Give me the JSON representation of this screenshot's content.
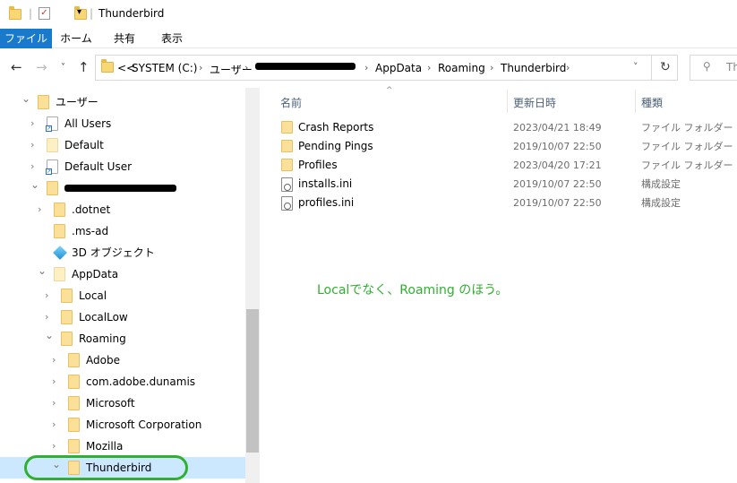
{
  "window": {
    "title": "Thunderbird"
  },
  "ribbon": {
    "tabs": [
      {
        "label": "ファイル",
        "active": true
      },
      {
        "label": "ホーム"
      },
      {
        "label": "共有"
      },
      {
        "label": "表示"
      }
    ],
    "active_color": "#1979ca"
  },
  "address": {
    "overflow": "<<",
    "crumbs": [
      "SYSTEM (C:)",
      "ユーザー",
      "AppData",
      "Roaming",
      "Thunderbird"
    ],
    "search_placeholder": "Th"
  },
  "nav": {
    "items": [
      {
        "label": "ユーザー",
        "indent": 0,
        "expanded": true,
        "icon": "folder"
      },
      {
        "label": "All Users",
        "indent": 1,
        "expanded": false,
        "icon": "shortcut-folder"
      },
      {
        "label": "Default",
        "indent": 1,
        "expanded": false,
        "icon": "folder-light"
      },
      {
        "label": "Default User",
        "indent": 1,
        "expanded": false,
        "icon": "shortcut-folder"
      },
      {
        "label": "",
        "indent": 1,
        "expanded": true,
        "icon": "folder",
        "redacted": true
      },
      {
        "label": ".dotnet",
        "indent": 2,
        "expanded": false,
        "icon": "folder"
      },
      {
        "label": ".ms-ad",
        "indent": 2,
        "expanded": null,
        "icon": "folder"
      },
      {
        "label": "3D オブジェクト",
        "indent": 2,
        "expanded": null,
        "icon": "3d-objects"
      },
      {
        "label": "AppData",
        "indent": 2,
        "expanded": true,
        "icon": "folder-light"
      },
      {
        "label": "Local",
        "indent": 3,
        "expanded": false,
        "icon": "folder"
      },
      {
        "label": "LocalLow",
        "indent": 3,
        "expanded": false,
        "icon": "folder"
      },
      {
        "label": "Roaming",
        "indent": 3,
        "expanded": true,
        "icon": "folder"
      },
      {
        "label": "Adobe",
        "indent": 4,
        "expanded": false,
        "icon": "folder"
      },
      {
        "label": "com.adobe.dunamis",
        "indent": 4,
        "expanded": false,
        "icon": "folder"
      },
      {
        "label": "Microsoft",
        "indent": 4,
        "expanded": false,
        "icon": "folder"
      },
      {
        "label": "Microsoft Corporation",
        "indent": 4,
        "expanded": false,
        "icon": "folder"
      },
      {
        "label": "Mozilla",
        "indent": 4,
        "expanded": false,
        "icon": "folder"
      },
      {
        "label": "Thunderbird",
        "indent": 4,
        "expanded": true,
        "icon": "folder",
        "selected": true
      }
    ],
    "highlight_color": "#cce8ff",
    "circle_color": "#2fb12f"
  },
  "list": {
    "headers": {
      "name": "名前",
      "date": "更新日時",
      "type": "種類"
    },
    "rows": [
      {
        "name": "Crash Reports",
        "date": "2023/04/21 18:49",
        "type": "ファイル フォルダー",
        "icon": "folder"
      },
      {
        "name": "Pending Pings",
        "date": "2019/10/07 22:50",
        "type": "ファイル フォルダー",
        "icon": "folder"
      },
      {
        "name": "Profiles",
        "date": "2023/04/20 17:21",
        "type": "ファイル フォルダー",
        "icon": "folder"
      },
      {
        "name": "installs.ini",
        "date": "2019/10/07 22:50",
        "type": "構成設定",
        "icon": "ini-file"
      },
      {
        "name": "profiles.ini",
        "date": "2019/10/07 22:50",
        "type": "構成設定",
        "icon": "ini-file"
      }
    ]
  },
  "annotation": {
    "text": "Localでなく、Roaming のほう。",
    "color": "#2fb12f"
  }
}
